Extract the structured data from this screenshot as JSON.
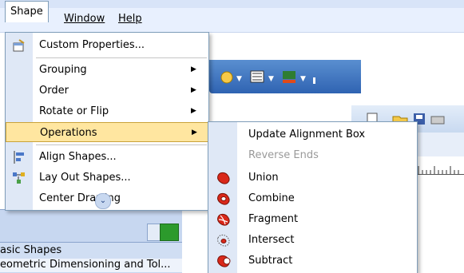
{
  "menubar": {
    "shape": "Shape",
    "window": "Window",
    "help": "Help"
  },
  "shape_menu": {
    "custom_properties": "Custom Properties...",
    "grouping": "Grouping",
    "order": "Order",
    "rotate_or_flip": "Rotate or Flip",
    "operations": "Operations",
    "align_shapes": "Align Shapes...",
    "lay_out_shapes": "Lay Out Shapes...",
    "center_drawing": "Center Drawing"
  },
  "operations_menu": {
    "update_alignment_box": "Update Alignment Box",
    "reverse_ends": "Reverse Ends",
    "union": "Union",
    "combine": "Combine",
    "fragment": "Fragment",
    "intersect": "Intersect",
    "subtract": "Subtract"
  },
  "left_panel": {
    "shapes_header": "asic Shapes",
    "shapes_item": "eometric Dimensioning and Tol..."
  },
  "icons": {
    "custom_properties": "properties-icon",
    "align_shapes": "align-shapes-icon",
    "lay_out_shapes": "layout-shapes-icon",
    "union": "union-icon",
    "combine": "combine-icon",
    "fragment": "fragment-icon",
    "intersect": "intersect-icon",
    "subtract": "subtract-icon"
  },
  "colors": {
    "highlight": "#ffe6a0",
    "operation_red": "#d9281a",
    "menu_gutter": "#dfe8f6"
  }
}
